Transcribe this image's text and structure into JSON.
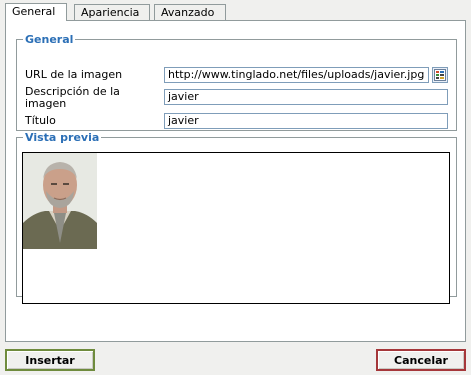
{
  "tabs": [
    {
      "label": "General",
      "active": true
    },
    {
      "label": "Apariencia",
      "active": false
    },
    {
      "label": "Avanzado",
      "active": false
    }
  ],
  "general": {
    "legend": "General",
    "url_label": "URL de la imagen",
    "url_value": "http://www.tinglado.net/files/uploads/javier.jpg",
    "desc_label": "Descripción de la imagen",
    "desc_value": "javier",
    "title_label": "Título",
    "title_value": "javier"
  },
  "preview": {
    "legend": "Vista previa"
  },
  "buttons": {
    "insert": "Insertar",
    "cancel": "Cancelar"
  },
  "icons": {
    "browse": "image-browser-icon",
    "photo": "portrait-photo"
  },
  "colors": {
    "legend": "#2b6fb6",
    "insert_border": "#6f8b3d",
    "cancel_border": "#a5373a"
  }
}
